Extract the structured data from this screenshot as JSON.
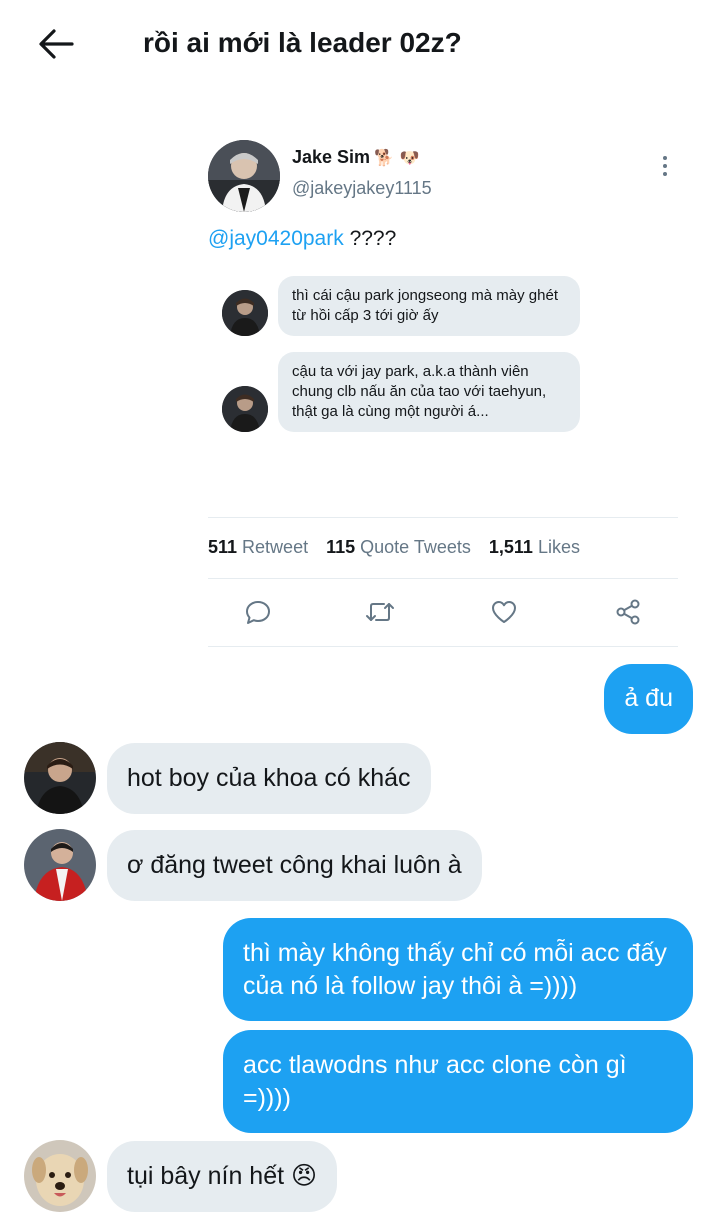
{
  "header": {
    "back_icon": "arrow-left-icon",
    "title": "rồi ai mới là leader 02z?"
  },
  "tweet": {
    "author_name": "Jake Sim",
    "author_emojis": "🐕 🐶",
    "handle": "@jakeyjakey1115",
    "mention": "@jay0420park",
    "text_rest": " ????",
    "media_messages": [
      {
        "text": "thì cái cậu park jongseong mà mày ghét từ hồi cấp 3 tới giờ ấy"
      },
      {
        "text": "cậu ta với jay park, a.k.a thành viên chung clb nấu ăn của tao với taehyun, thật ga là cùng một người á..."
      }
    ],
    "stats": {
      "retweets_count": "511",
      "retweets_label": "Retweet",
      "quotes_count": "115",
      "quotes_label": "Quote Tweets",
      "likes_count": "1,511",
      "likes_label": "Likes"
    },
    "actions": [
      "reply-icon",
      "retweet-icon",
      "like-icon",
      "share-icon"
    ]
  },
  "messages": [
    {
      "from": "me",
      "text": "ả đu"
    },
    {
      "from": "other",
      "text": "hot boy của khoa có khác"
    },
    {
      "from": "other",
      "text": "ơ đăng tweet công khai luôn à"
    },
    {
      "from": "me",
      "text": "thì mày không thấy chỉ có mỗi acc đấy của nó là follow jay thôi à =))))"
    },
    {
      "from": "me",
      "text": "acc tlawodns như acc clone còn gì =))))"
    },
    {
      "from": "other",
      "text": "tụi bây nín hết 😠"
    }
  ],
  "colors": {
    "accent": "#1da1f2",
    "incoming_bubble": "#e6ecf0",
    "secondary_text": "#657786"
  }
}
